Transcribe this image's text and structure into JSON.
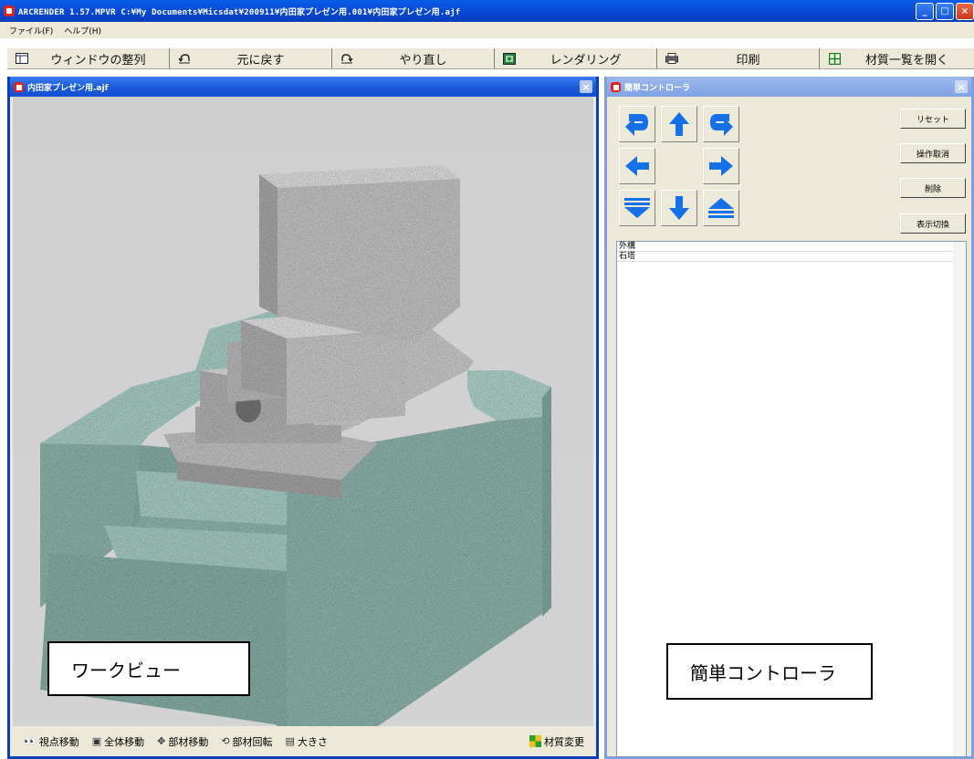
{
  "window": {
    "title": "ARCRENDER 1.57.MPVR   C:¥My Documents¥Micsdat¥200911¥内田家プレゼン用.001¥内田家プレゼン用.ajf",
    "controls": {
      "minimize": "_",
      "maximize": "□",
      "close": "×"
    }
  },
  "menu": {
    "items": [
      "ファイル(F)",
      "ヘルプ(H)"
    ]
  },
  "toolbar": {
    "buttons": [
      {
        "label": "ウィンドウの整列",
        "icon": "windows-icon"
      },
      {
        "label": "元に戻す",
        "icon": "undo-icon"
      },
      {
        "label": "やり直し",
        "icon": "redo-icon"
      },
      {
        "label": "レンダリング",
        "icon": "render-icon"
      },
      {
        "label": "印刷",
        "icon": "printer-icon"
      },
      {
        "label": "材質一覧を開く",
        "icon": "grid-icon"
      }
    ]
  },
  "work_view": {
    "title": "内田家プレゼン用.ajf",
    "annotation": "ワークビュー",
    "bottom_tools": [
      {
        "label": "視点移動",
        "icon": "eye-icon",
        "glyph": "👀"
      },
      {
        "label": "全体移動",
        "icon": "move-all-icon",
        "glyph": "▣"
      },
      {
        "label": "部材移動",
        "icon": "move-part-icon",
        "glyph": "✥"
      },
      {
        "label": "部材回転",
        "icon": "rotate-icon",
        "glyph": "⟲"
      },
      {
        "label": "大きさ",
        "icon": "size-icon",
        "glyph": "▤"
      }
    ],
    "material_change": "材質変更"
  },
  "controller": {
    "title": "簡単コントローラ",
    "annotation": "簡単コントローラ",
    "side_buttons": [
      "リセット",
      "操作取消",
      "削除",
      "表示切換"
    ],
    "list_items": [
      "外構",
      "石塔"
    ],
    "arrow_buttons": [
      "rotate-left",
      "up",
      "rotate-right",
      "left",
      "right",
      "down-layer",
      "down",
      "up-layer"
    ]
  },
  "colors": {
    "title_bar": "#0a5ee8",
    "panel_border": "#0b3fb6",
    "arrow_blue": "#1670e8",
    "granite_gray": "#a8a8a8",
    "granite_green": "#8fb3ad"
  }
}
